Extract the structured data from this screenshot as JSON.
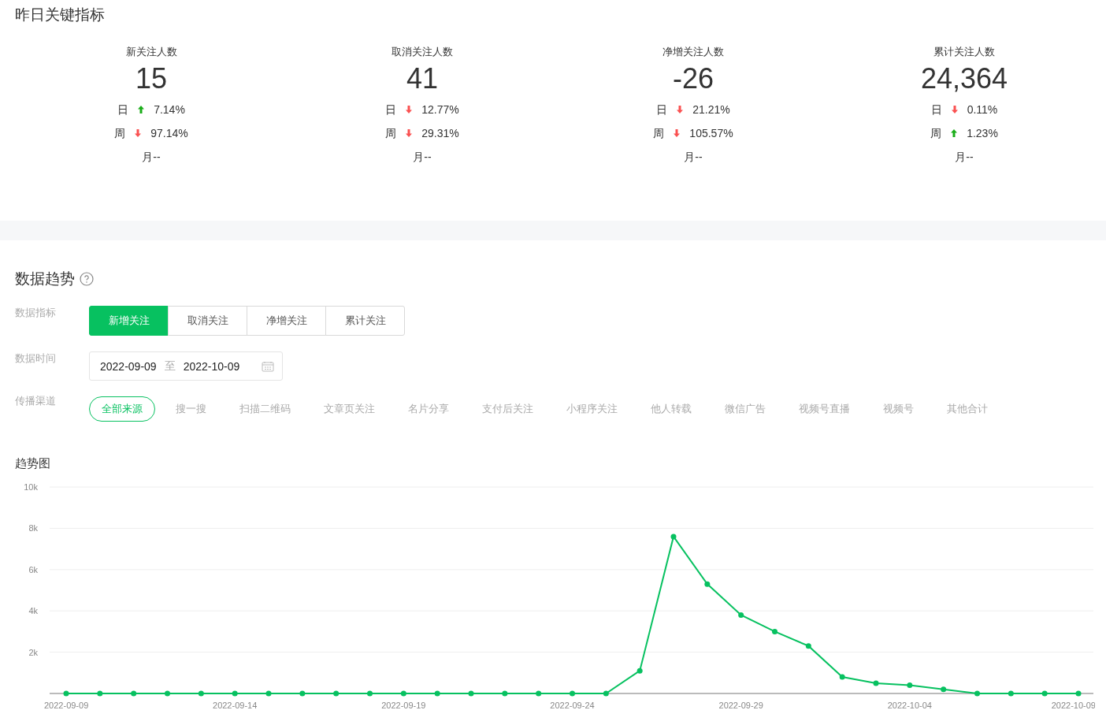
{
  "overview": {
    "title": "昨日关键指标",
    "metrics": [
      {
        "label": "新关注人数",
        "value": "15",
        "changes": [
          {
            "period": "日",
            "rising": true,
            "percent": "7.14%"
          },
          {
            "period": "周",
            "rising": false,
            "percent": "97.14%"
          }
        ],
        "month": "月--"
      },
      {
        "label": "取消关注人数",
        "value": "41",
        "changes": [
          {
            "period": "日",
            "rising": false,
            "percent": "12.77%"
          },
          {
            "period": "周",
            "rising": false,
            "percent": "29.31%"
          }
        ],
        "month": "月--"
      },
      {
        "label": "净增关注人数",
        "value": "-26",
        "changes": [
          {
            "period": "日",
            "rising": false,
            "percent": "21.21%"
          },
          {
            "period": "周",
            "rising": false,
            "percent": "105.57%"
          }
        ],
        "month": "月--"
      },
      {
        "label": "累计关注人数",
        "value": "24,364",
        "changes": [
          {
            "period": "日",
            "rising": false,
            "percent": "0.11%"
          },
          {
            "period": "周",
            "rising": true,
            "percent": "1.23%"
          }
        ],
        "month": "月--"
      }
    ]
  },
  "trend": {
    "title": "数据趋势",
    "metric_label": "数据指标",
    "metric_tabs": [
      {
        "label": "新增关注",
        "selected": true
      },
      {
        "label": "取消关注",
        "selected": false
      },
      {
        "label": "净增关注",
        "selected": false
      },
      {
        "label": "累计关注",
        "selected": false
      }
    ],
    "time_label": "数据时间",
    "date_range": {
      "start": "2022-09-09",
      "separator": "至",
      "end": "2022-10-09"
    },
    "channel_label": "传播渠道",
    "channels": [
      {
        "label": "全部来源",
        "selected": true
      },
      {
        "label": "搜一搜",
        "selected": false
      },
      {
        "label": "扫描二维码",
        "selected": false
      },
      {
        "label": "文章页关注",
        "selected": false
      },
      {
        "label": "名片分享",
        "selected": false
      },
      {
        "label": "支付后关注",
        "selected": false
      },
      {
        "label": "小程序关注",
        "selected": false
      },
      {
        "label": "他人转载",
        "selected": false
      },
      {
        "label": "微信广告",
        "selected": false
      },
      {
        "label": "视频号直播",
        "selected": false
      },
      {
        "label": "视频号",
        "selected": false
      },
      {
        "label": "其他合计",
        "selected": false
      }
    ],
    "chart_title": "趋势图",
    "chart_data": {
      "type": "line",
      "ylim": [
        0,
        10000
      ],
      "grid": true,
      "yticks": [
        {
          "value": 2000,
          "label": "2k"
        },
        {
          "value": 4000,
          "label": "4k"
        },
        {
          "value": 6000,
          "label": "6k"
        },
        {
          "value": 8000,
          "label": "8k"
        },
        {
          "value": 10000,
          "label": "10k"
        }
      ],
      "categories": [
        "2022-09-09",
        null,
        null,
        null,
        null,
        "2022-09-14",
        null,
        null,
        null,
        null,
        "2022-09-19",
        null,
        null,
        null,
        null,
        "2022-09-24",
        null,
        null,
        null,
        null,
        "2022-09-29",
        null,
        null,
        null,
        null,
        "2022-10-04",
        null,
        null,
        null,
        null,
        "2022-10-09"
      ],
      "series": [
        {
          "color": "#07c160",
          "marker": true,
          "values": [
            0,
            0,
            0,
            0,
            0,
            0,
            0,
            0,
            0,
            0,
            0,
            0,
            0,
            0,
            0,
            0,
            0,
            1100,
            7600,
            5300,
            3800,
            3000,
            2300,
            800,
            500,
            400,
            200,
            0,
            0,
            0,
            0
          ]
        }
      ]
    }
  }
}
